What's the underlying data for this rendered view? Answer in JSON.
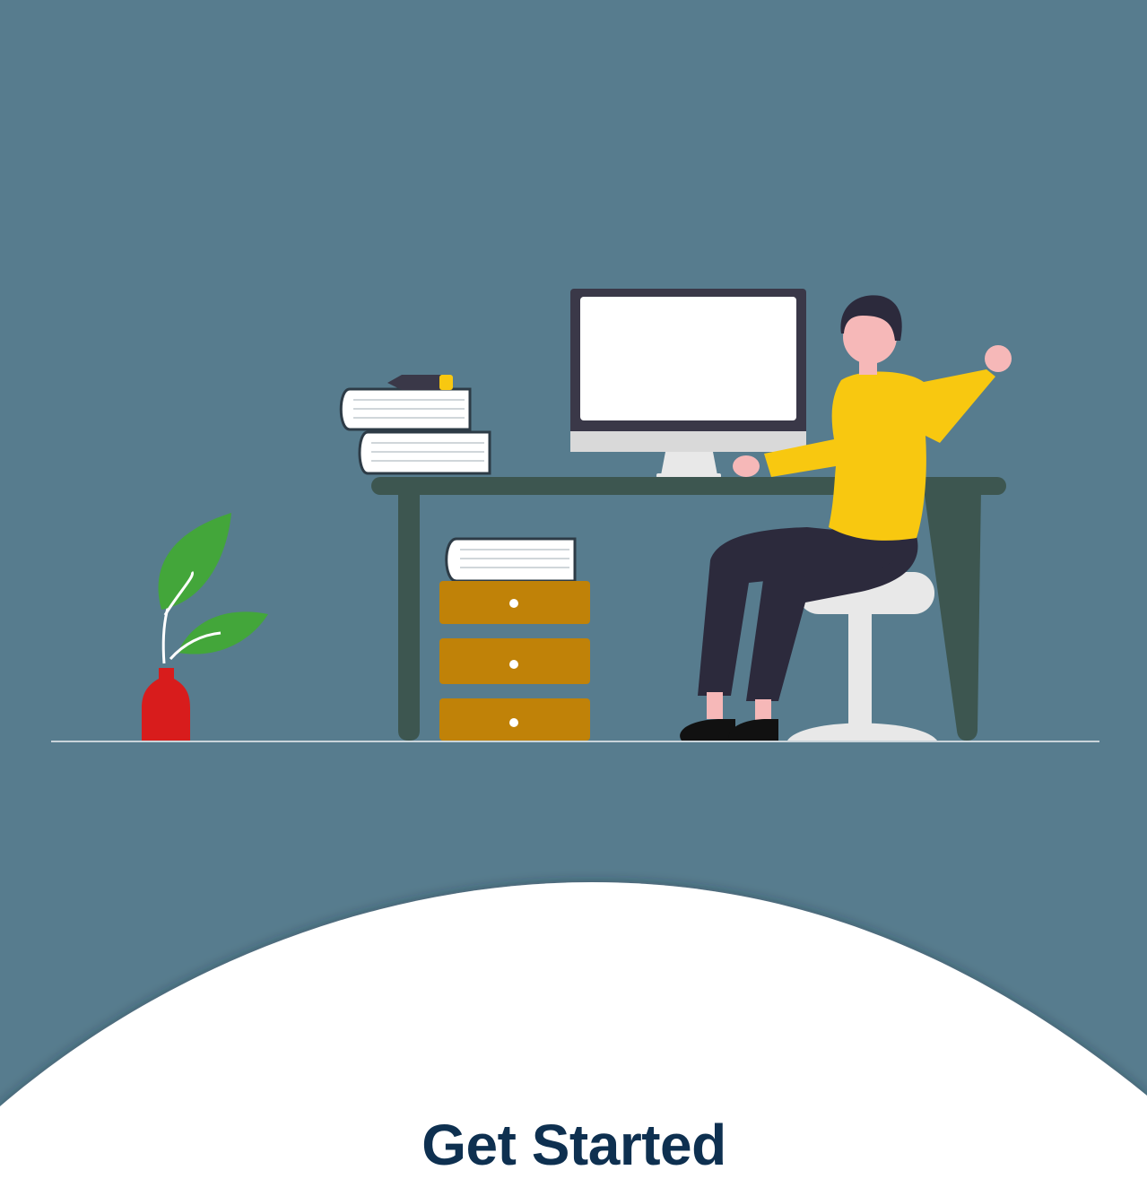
{
  "onboarding": {
    "cta_label": "Get Started"
  },
  "illustration": {
    "subject": "person-working-at-desk",
    "icons": [
      "potted-plant-icon",
      "book-stack-icon",
      "pen-icon",
      "monitor-icon",
      "desk-icon",
      "drawer-cabinet-icon",
      "person-icon",
      "stool-icon"
    ]
  },
  "colors": {
    "background": "#577c8e",
    "sheet": "#ffffff",
    "cta_text": "#0e3050",
    "desk": "#3d5650",
    "shirt": "#f8c810",
    "pants": "#2c2a3c",
    "vase": "#d81c1c",
    "leaf": "#43a63a",
    "drawer": "#c08208",
    "monitor_frame": "#3a3848"
  }
}
